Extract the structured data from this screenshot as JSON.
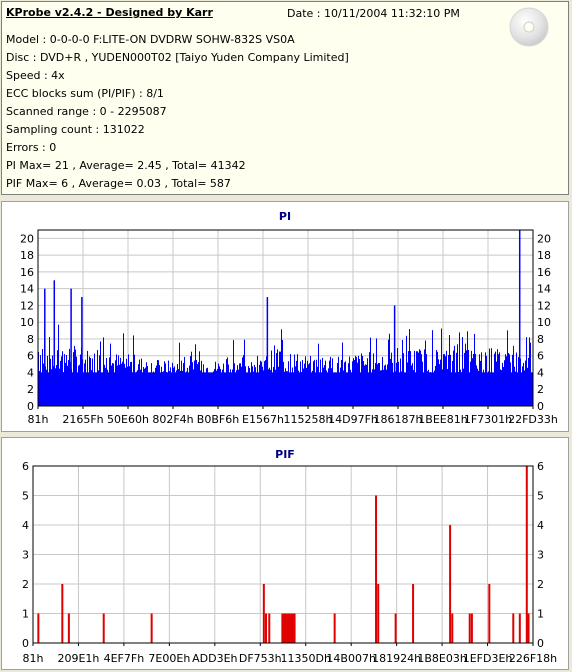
{
  "header": {
    "app_title": "KProbe v2.4.2 - Designed by Karr",
    "date": "Date : 10/11/2004 11:32:10 PM"
  },
  "info_lines": [
    "Model : 0-0-0-0 F:LITE-ON DVDRW SOHW-832S  VS0A",
    "Disc : DVD+R , YUDEN000T02 [Taiyo Yuden Company Limited]",
    "Speed : 4x",
    "ECC blocks sum (PI/PIF) : 8/1",
    "Scanned range : 0 - 2295087",
    "Sampling count : 131022",
    "Errors : 0",
    "PI Max= 21 , Average= 2.45 , Total= 41342",
    "PIF Max= 6 , Average= 0.03 , Total= 587"
  ],
  "icons": {
    "disc": "disc-icon"
  },
  "colors": {
    "background": "#ece9d8",
    "info_panel": "#ffffef",
    "pi_bars": "#0000ff",
    "pif_bars": "#e00000",
    "title": "#000080",
    "grid": "#c8c8c8"
  },
  "chart_data": [
    {
      "type": "bar",
      "title": "PI",
      "ylim": [
        0,
        21
      ],
      "yticks": [
        0,
        2,
        4,
        6,
        8,
        10,
        12,
        14,
        16,
        18,
        20
      ],
      "x_range": [
        0,
        2295087
      ],
      "xtick_labels": [
        "81h",
        "2165Fh",
        "50E60h",
        "802F4h",
        "B0BF6h",
        "E1567h",
        "115258h",
        "14D97Fh",
        "186187h",
        "1BEE81h",
        "1F7301h",
        "22FD33h"
      ],
      "grid": true,
      "profile": {
        "baseline": 4.5,
        "fill_level": 4,
        "positions": [
          0,
          0.02,
          0.04,
          0.06,
          0.09,
          0.15,
          0.25,
          0.35,
          0.45,
          0.48,
          0.5,
          0.52,
          0.55,
          0.6,
          0.65,
          0.7,
          0.75,
          0.8,
          0.85,
          0.9,
          0.95,
          0.97,
          1.0
        ],
        "typical": [
          8,
          7,
          6,
          6,
          5.5,
          5,
          4,
          4,
          4,
          6,
          6,
          5,
          4.5,
          4.5,
          5,
          5,
          5.5,
          5.5,
          5.5,
          5.5,
          5.5,
          5,
          5
        ]
      },
      "peaks": [
        {
          "x": 28000,
          "value": 14
        },
        {
          "x": 72000,
          "value": 15
        },
        {
          "x": 150000,
          "value": 14
        },
        {
          "x": 200000,
          "value": 13
        },
        {
          "x": 1060000,
          "value": 13
        },
        {
          "x": 1650000,
          "value": 12
        },
        {
          "x": 2230000,
          "value": 21
        }
      ]
    },
    {
      "type": "bar",
      "title": "PIF",
      "ylim": [
        0,
        6
      ],
      "yticks": [
        0,
        1,
        2,
        3,
        4,
        5,
        6
      ],
      "x_range": [
        0,
        2295087
      ],
      "xtick_labels": [
        "81h",
        "209E1h",
        "4EF7Fh",
        "7E00Eh",
        "ADD3Eh",
        "DF753h",
        "11350Dh",
        "14B007h",
        "181924h",
        "1B8E03h",
        "1EFD3Eh",
        "226F18h"
      ],
      "grid": true,
      "points": [
        {
          "x": 20000,
          "value": 1
        },
        {
          "x": 130000,
          "value": 2
        },
        {
          "x": 160000,
          "value": 1
        },
        {
          "x": 320000,
          "value": 1
        },
        {
          "x": 540000,
          "value": 1
        },
        {
          "x": 1055000,
          "value": 2
        },
        {
          "x": 1065000,
          "value": 1
        },
        {
          "x": 1080000,
          "value": 1
        },
        {
          "x": 1140000,
          "value": 1
        },
        {
          "x": 1148000,
          "value": 1
        },
        {
          "x": 1156000,
          "value": 1
        },
        {
          "x": 1164000,
          "value": 1
        },
        {
          "x": 1172000,
          "value": 1
        },
        {
          "x": 1180000,
          "value": 1
        },
        {
          "x": 1188000,
          "value": 1
        },
        {
          "x": 1196000,
          "value": 1
        },
        {
          "x": 1380000,
          "value": 1
        },
        {
          "x": 1570000,
          "value": 5
        },
        {
          "x": 1580000,
          "value": 2
        },
        {
          "x": 1660000,
          "value": 1
        },
        {
          "x": 1740000,
          "value": 2
        },
        {
          "x": 1910000,
          "value": 4
        },
        {
          "x": 1920000,
          "value": 1
        },
        {
          "x": 2000000,
          "value": 1
        },
        {
          "x": 2010000,
          "value": 1
        },
        {
          "x": 2090000,
          "value": 2
        },
        {
          "x": 2200000,
          "value": 1
        },
        {
          "x": 2230000,
          "value": 1
        },
        {
          "x": 2262000,
          "value": 6
        },
        {
          "x": 2270000,
          "value": 1
        }
      ]
    }
  ]
}
